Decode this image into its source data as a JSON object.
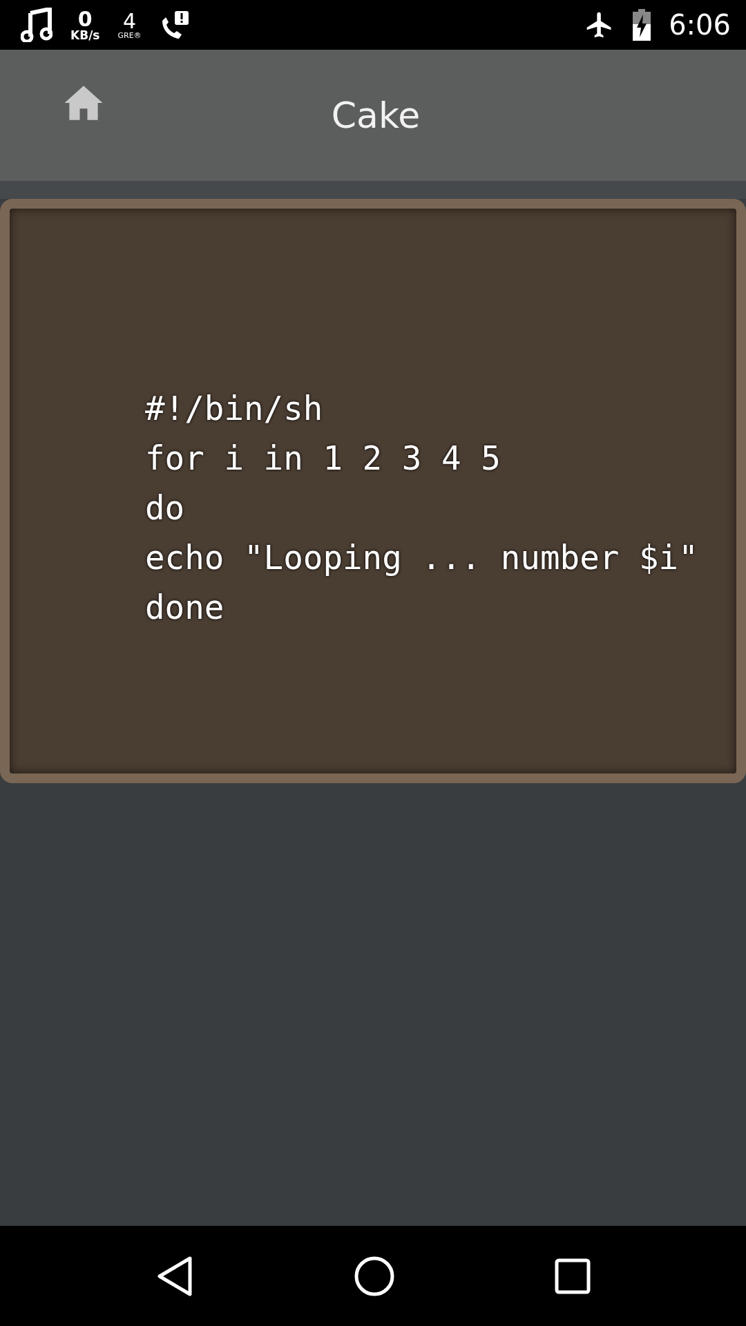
{
  "status_bar": {
    "speed_value": "0",
    "speed_unit": "KB/s",
    "network_value": "4",
    "network_label": "GRE®",
    "time": "6:06"
  },
  "app_bar": {
    "title": "Cake"
  },
  "code_card": {
    "lines": [
      "#!/bin/sh",
      "for i in 1 2 3 4 5",
      "do",
      "echo \"Looping ... number $i\"",
      "done"
    ]
  }
}
